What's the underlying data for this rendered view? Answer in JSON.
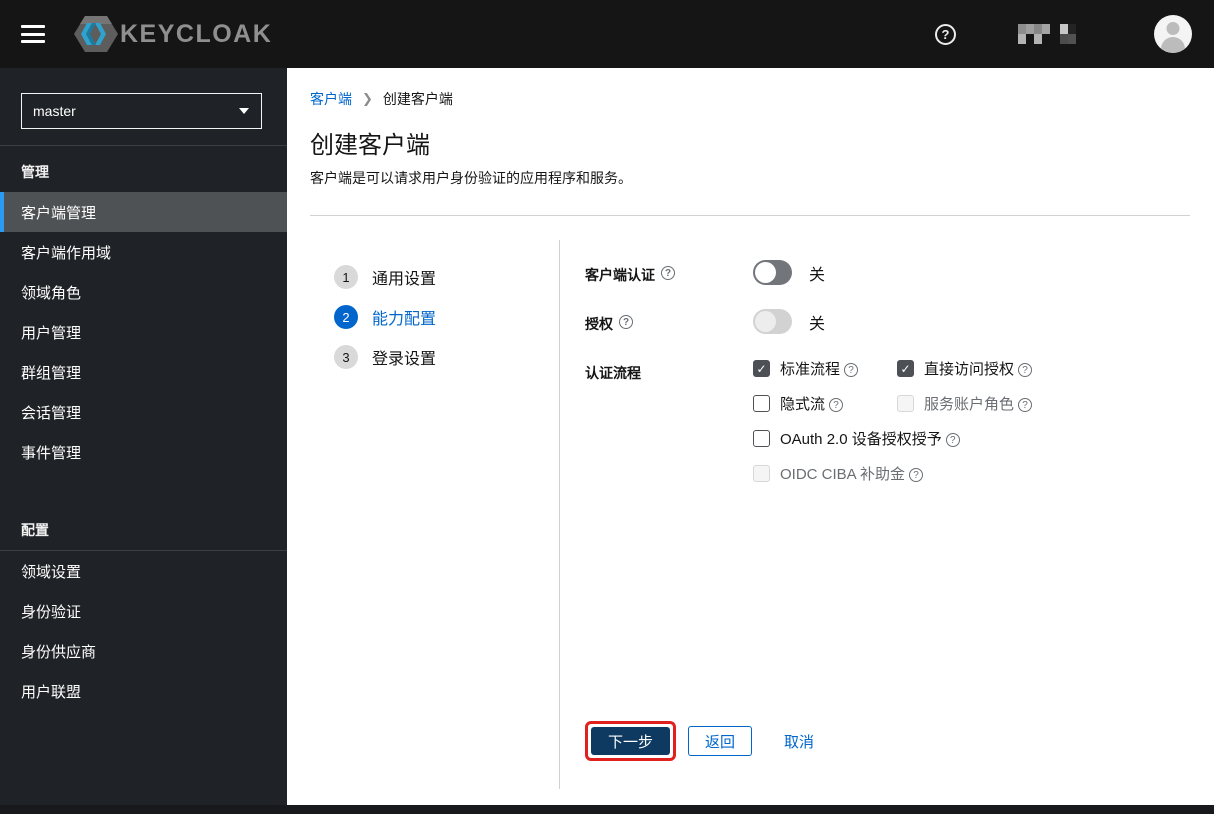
{
  "masthead": {
    "logo_text": "KEYCLOAK",
    "help_icon": "question-circle-icon",
    "username_redacted": true,
    "avatar_icon": "user-avatar-icon"
  },
  "sidebar": {
    "realm_selector": {
      "value": "master"
    },
    "sections": [
      {
        "label": "管理",
        "items": [
          {
            "label": "客户端管理",
            "active": true
          },
          {
            "label": "客户端作用域",
            "active": false
          },
          {
            "label": "领域角色",
            "active": false
          },
          {
            "label": "用户管理",
            "active": false
          },
          {
            "label": "群组管理",
            "active": false
          },
          {
            "label": "会话管理",
            "active": false
          },
          {
            "label": "事件管理",
            "active": false
          }
        ]
      },
      {
        "label": "配置",
        "items": [
          {
            "label": "领域设置",
            "active": false
          },
          {
            "label": "身份验证",
            "active": false
          },
          {
            "label": "身份供应商",
            "active": false
          },
          {
            "label": "用户联盟",
            "active": false
          }
        ]
      }
    ]
  },
  "breadcrumb": {
    "items": [
      {
        "label": "客户端",
        "link": true
      },
      {
        "label": "创建客户端",
        "link": false
      }
    ]
  },
  "page": {
    "title": "创建客户端",
    "subtitle": "客户端是可以请求用户身份验证的应用程序和服务。"
  },
  "wizard": {
    "steps": [
      {
        "number": "1",
        "label": "通用设置",
        "state": "inactive"
      },
      {
        "number": "2",
        "label": "能力配置",
        "state": "current"
      },
      {
        "number": "3",
        "label": "登录设置",
        "state": "inactive"
      }
    ]
  },
  "form": {
    "client_authentication": {
      "label": "客户端认证",
      "value": "关",
      "switch_on": false,
      "disabled": false
    },
    "authorization": {
      "label": "授权",
      "value": "关",
      "switch_on": false,
      "disabled": true
    },
    "authentication_flow": {
      "label": "认证流程",
      "options": [
        {
          "label": "标准流程",
          "checked": true,
          "disabled": false
        },
        {
          "label": "直接访问授权",
          "checked": true,
          "disabled": false
        },
        {
          "label": "隐式流",
          "checked": false,
          "disabled": false
        },
        {
          "label": "服务账户角色",
          "checked": false,
          "disabled": true
        },
        {
          "label": "OAuth 2.0 设备授权授予",
          "checked": false,
          "disabled": false
        },
        {
          "label": "OIDC CIBA 补助金",
          "checked": false,
          "disabled": true
        }
      ]
    }
  },
  "actions": {
    "next_label": "下一步",
    "back_label": "返回",
    "cancel_label": "取消",
    "next_annotated": true
  },
  "colors": {
    "accent": "#0066cc",
    "primary_button": "#0e3a61",
    "annotation_highlight": "#e0211d",
    "masthead_bg": "#151515",
    "sidebar_bg": "#1f2226",
    "nav_active_bg": "#4f5255",
    "nav_active_border": "#2b9af3",
    "divider": "#d2d2d2",
    "checkbox_checked": "#4d5156",
    "disabled_text": "#6a6e73",
    "switch_off_track": "#72767b"
  }
}
